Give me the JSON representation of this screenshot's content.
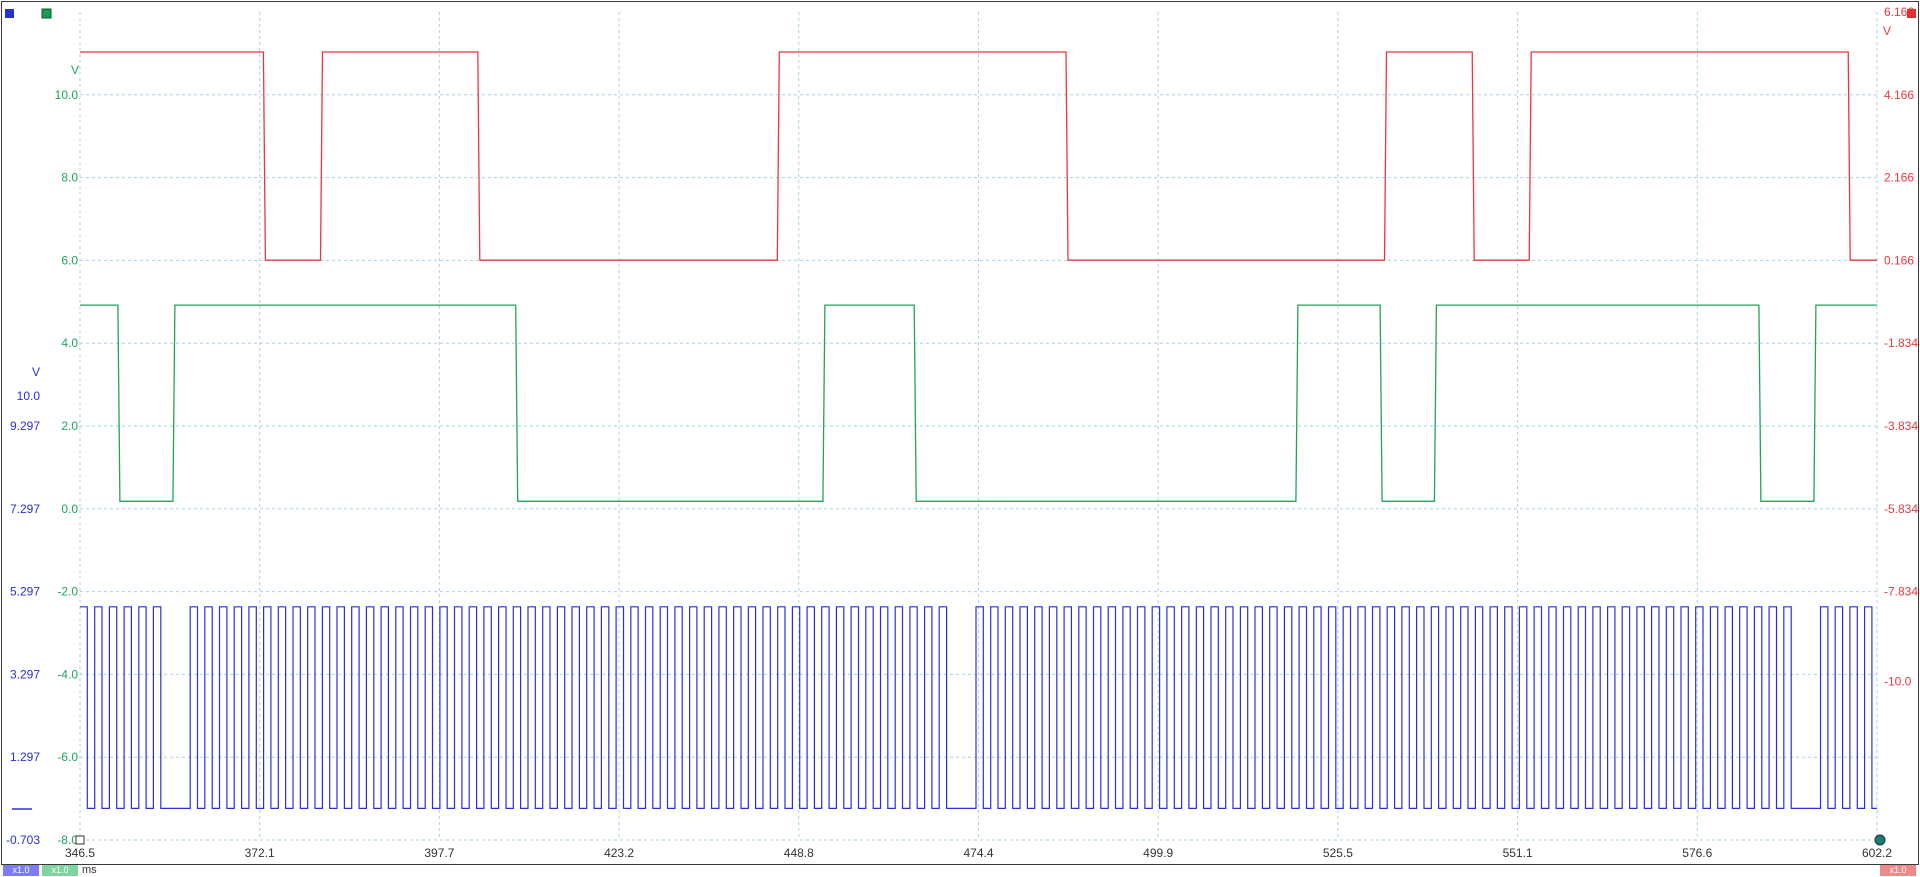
{
  "window": {
    "x_unit": "ms",
    "channel_scale_labels": [
      "x1.0",
      "x1.0",
      "x1.0"
    ]
  },
  "colors": {
    "channel_a": "#e8383f",
    "channel_b": "#22a35a",
    "channel_c": "#2e2ed8",
    "grid": "#a9d3e6",
    "frame": "#3a3a3a"
  },
  "chart_data": {
    "type": "line",
    "x_range": [
      346.5,
      602.2
    ],
    "x_ticks": [
      "346.5",
      "372.1",
      "397.7",
      "423.2",
      "448.8",
      "474.4",
      "499.9",
      "525.5",
      "551.1",
      "576.6",
      "602.2"
    ],
    "axes": {
      "green": {
        "unit": "V",
        "range": [
          -8.0,
          12.0
        ],
        "ticks": [
          "10.0",
          "8.0",
          "6.0",
          "4.0",
          "2.0",
          "0.0",
          "-2.0",
          "-4.0",
          "-6.0",
          "-8.0"
        ]
      },
      "blue": {
        "unit": "V",
        "range": [
          -0.703,
          19.297
        ],
        "ticks": [
          "10.0",
          "9.297",
          "7.297",
          "5.297",
          "3.297",
          "1.297",
          "-0.703"
        ]
      },
      "red": {
        "unit": "V",
        "range": [
          -13.834,
          6.166
        ],
        "ticks": [
          "6.166",
          "4.166",
          "2.166",
          "0.166",
          "-1.834",
          "-3.834",
          "-5.834",
          "-7.834",
          "-10.0"
        ]
      }
    },
    "series": [
      {
        "color": "#e8383f",
        "axis": "red",
        "high": 5.2,
        "low": 0.17,
        "low_intervals_ms": [
          [
            372.6,
            381.0
          ],
          [
            403.1,
            446.0
          ],
          [
            486.8,
            532.4
          ],
          [
            544.6,
            553.0
          ],
          [
            598.1,
            606.0
          ]
        ]
      },
      {
        "color": "#22a35a",
        "axis": "green",
        "high": 4.92,
        "low": 0.18,
        "low_intervals_ms": [
          [
            351.9,
            360.0
          ],
          [
            408.5,
            452.5
          ],
          [
            465.2,
            519.8
          ],
          [
            531.5,
            539.5
          ],
          [
            585.4,
            593.5
          ]
        ]
      },
      {
        "color": "#2e2ed8",
        "axis": "blue",
        "high": 4.93,
        "low": 0.06,
        "period_ms": 2.09,
        "idle_low_ms": [
          [
            358.5,
            361.5
          ],
          [
            469.6,
            473.3
          ],
          [
            589.8,
            593.3
          ]
        ]
      }
    ]
  }
}
